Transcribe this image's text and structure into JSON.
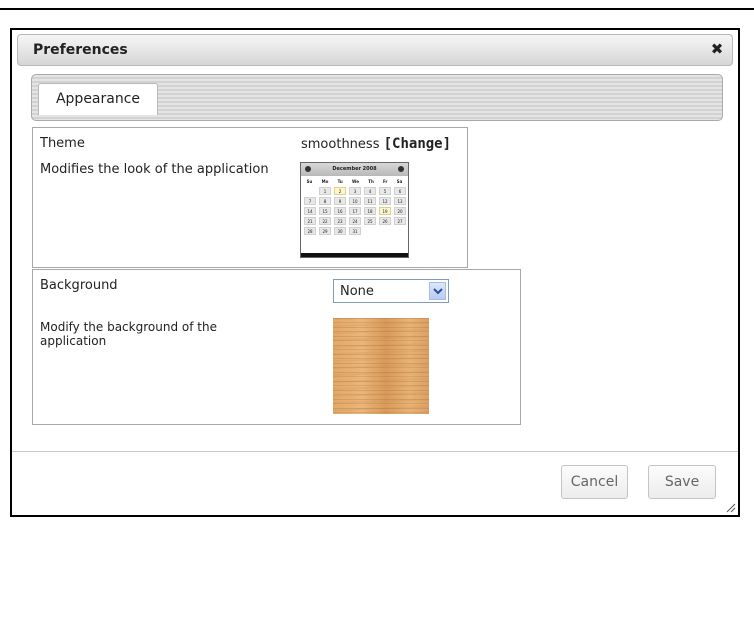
{
  "dialog": {
    "title": "Preferences",
    "close_glyph": "✖",
    "close_icon": "close-icon"
  },
  "tabs": [
    {
      "label": "Appearance",
      "selected": true
    }
  ],
  "theme": {
    "label": "Theme",
    "description": "Modifies the look of the application",
    "value": "smoothness",
    "change_link": "[Change]",
    "preview": {
      "month": "December 2008",
      "weekdays": [
        "Su",
        "Mo",
        "Tu",
        "We",
        "Th",
        "Fr",
        "Sa"
      ],
      "rows": [
        [
          "",
          "1",
          "2",
          "3",
          "4",
          "5",
          "6"
        ],
        [
          "7",
          "8",
          "9",
          "10",
          "11",
          "12",
          "13"
        ],
        [
          "14",
          "15",
          "16",
          "17",
          "18",
          "19",
          "20"
        ],
        [
          "21",
          "22",
          "23",
          "24",
          "25",
          "26",
          "27"
        ],
        [
          "28",
          "29",
          "30",
          "31",
          "",
          "",
          ""
        ]
      ],
      "highlighted": [
        "2",
        "19"
      ]
    }
  },
  "background": {
    "label": "Background",
    "description": "Modify the background of the application",
    "selected_option": "None",
    "preview": "wood-texture"
  },
  "buttons": {
    "cancel": "Cancel",
    "save": "Save"
  },
  "colors": {
    "titlebar": "#d6d6d6",
    "border": "#000000",
    "select_border": "#7f9db9"
  }
}
